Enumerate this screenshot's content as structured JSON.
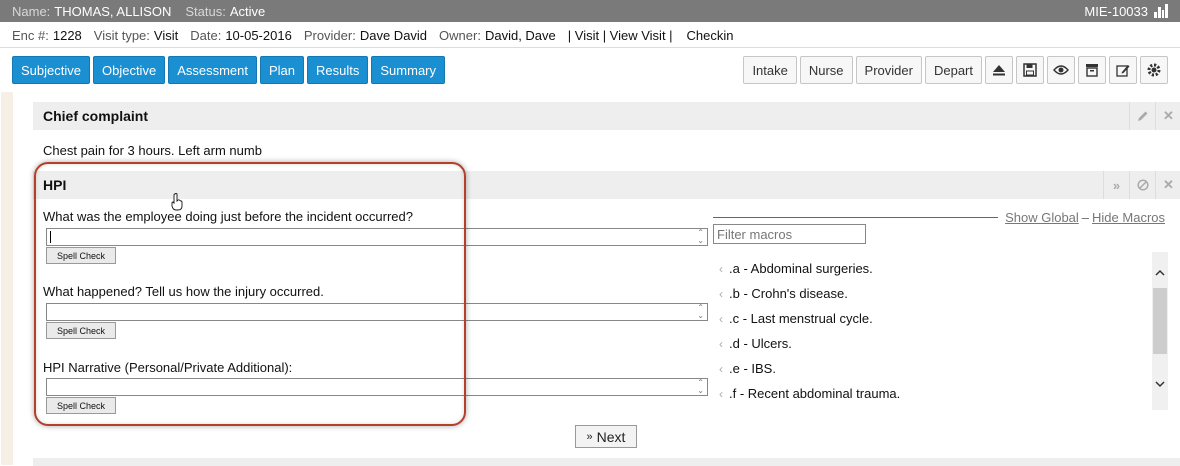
{
  "patient": {
    "name_label": "Name:",
    "name": "THOMAS, ALLISON",
    "status_label": "Status:",
    "status": "Active",
    "mrn": "MIE-10033"
  },
  "encounter": {
    "enc_label": "Enc #:",
    "enc": "1228",
    "visit_type_label": "Visit type:",
    "visit_type": "Visit",
    "date_label": "Date:",
    "date": "10-05-2016",
    "provider_label": "Provider:",
    "provider": "Dave David",
    "owner_label": "Owner:",
    "owner": "David, Dave",
    "links": "| Visit | View Visit |",
    "checkin": "Checkin"
  },
  "tabs": [
    "Subjective",
    "Objective",
    "Assessment",
    "Plan",
    "Results",
    "Summary"
  ],
  "tools": [
    "Intake",
    "Nurse",
    "Provider",
    "Depart"
  ],
  "tool_icons": [
    "eject-icon",
    "save-icon",
    "eye-icon",
    "archive-icon",
    "edit-icon",
    "gear-icon"
  ],
  "chief_complaint": {
    "title": "Chief complaint",
    "text": "Chest pain for 3 hours.  Left arm numb"
  },
  "hpi": {
    "title": "HPI",
    "questions": [
      "What was the employee doing just before the incident occurred?",
      "What happened? Tell us how the injury occurred.",
      "HPI Narrative (Personal/Private Additional):"
    ],
    "spell_check_label": "Spell Check"
  },
  "macros": {
    "show_global": "Show Global",
    "separator": "–",
    "hide_macros": "Hide Macros",
    "filter_placeholder": "Filter macros",
    "items": [
      ".a - Abdominal surgeries.",
      ".b - Crohn's disease.",
      ".c - Last menstrual cycle.",
      ".d - Ulcers.",
      ".e - IBS.",
      ".f - Recent abdominal trauma."
    ]
  },
  "next_label": "Next"
}
